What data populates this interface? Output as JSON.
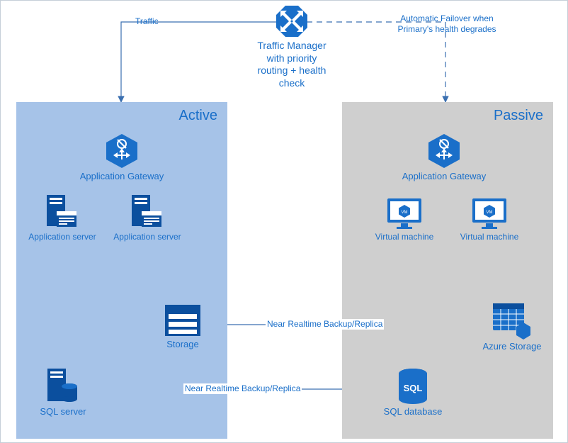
{
  "tm": {
    "caption": "Traffic Manager\nwith priority\nrouting + health\ncheck",
    "traffic_label": "Traffic",
    "failover_label": "Automatic Failover when\nPrimary's health degrades"
  },
  "active": {
    "title": "Active",
    "app_gateway": "Application Gateway",
    "app_server_1": "Application server",
    "app_server_2": "Application server",
    "storage": "Storage",
    "sql_server": "SQL server"
  },
  "passive": {
    "title": "Passive",
    "app_gateway": "Application Gateway",
    "vm_1": "Virtual machine",
    "vm_2": "Virtual machine",
    "azure_storage": "Azure Storage",
    "sql_database": "SQL database"
  },
  "replica": {
    "storage": "Near Realtime Backup/Replica",
    "sql": "Near Realtime Backup/Replica"
  },
  "colors": {
    "azure_blue": "#1a6fc9",
    "deep_blue": "#0b4f9e",
    "active_bg": "#a6c3e8",
    "passive_bg": "#cfcfcf"
  }
}
